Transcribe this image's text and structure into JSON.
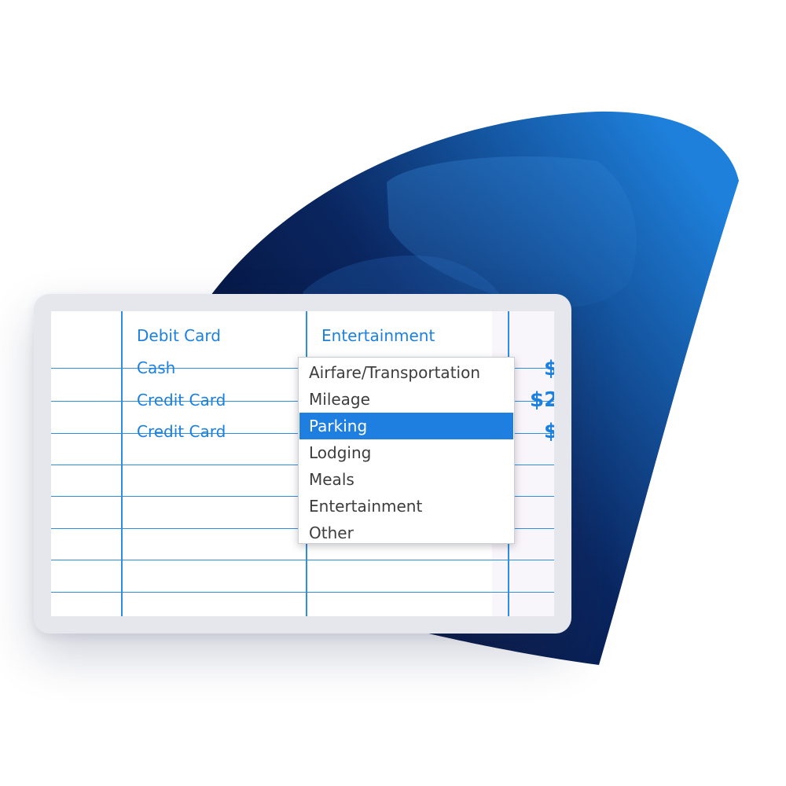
{
  "colors": {
    "accent": "#1b80de",
    "grid_line": "#2f8ee0",
    "selected_bg": "#1e7fe1",
    "backdrop_dark": "#081d4a",
    "backdrop_light": "#1c7ed8"
  },
  "sheet": {
    "header_row": {
      "payment_method": "Debit Card",
      "category": "Entertainment"
    },
    "rows": [
      {
        "payment_method": "Cash",
        "amount": "$"
      },
      {
        "payment_method": "Credit Card",
        "amount": "$2"
      },
      {
        "payment_method": "Credit Card",
        "amount": "$"
      }
    ]
  },
  "dropdown": {
    "options": [
      "Airfare/Transportation",
      "Mileage",
      "Parking",
      "Lodging",
      "Meals",
      "Entertainment",
      "Other"
    ],
    "selected": "Parking"
  }
}
